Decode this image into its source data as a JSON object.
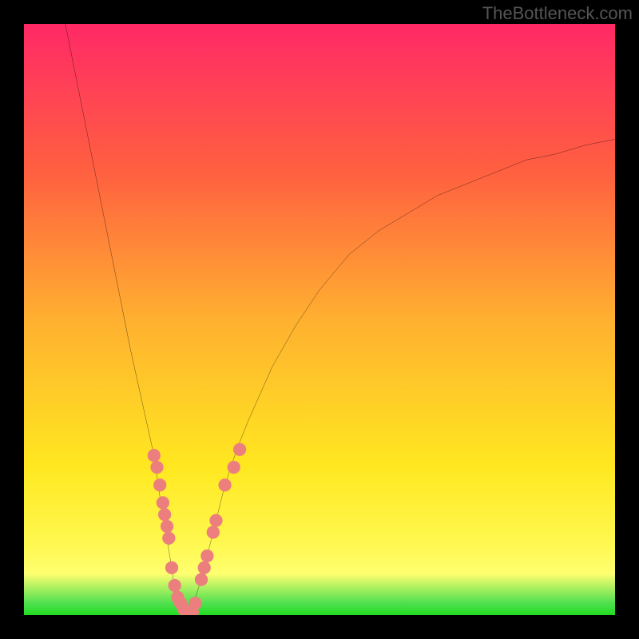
{
  "attribution": "TheBottleneck.com",
  "colors": {
    "background": "#000000",
    "gradient_top": "#FF2966",
    "gradient_upper_mid": "#FF6040",
    "gradient_mid": "#FFB030",
    "gradient_lower_mid": "#FFE820",
    "gradient_bottom_green": "#20DD20",
    "curve": "#000000",
    "markers": "#EC7F7E"
  },
  "chart_data": {
    "type": "line",
    "title": "",
    "xlabel": "",
    "ylabel": "",
    "xlim": [
      0,
      100
    ],
    "ylim": [
      0,
      100
    ],
    "left_curve": {
      "x": [
        7,
        10,
        13,
        16,
        18,
        20,
        22,
        23,
        24,
        25,
        25.5,
        26,
        27,
        28
      ],
      "y": [
        100,
        85,
        70,
        55,
        45,
        36,
        27,
        20,
        14,
        8,
        4,
        2,
        0,
        0
      ]
    },
    "right_curve": {
      "x": [
        28,
        30,
        32,
        34,
        36,
        38,
        42,
        46,
        50,
        55,
        60,
        65,
        70,
        75,
        80,
        85,
        90,
        95,
        100
      ],
      "y": [
        0,
        6,
        14,
        22,
        28,
        33,
        42,
        49,
        55,
        61,
        65,
        68,
        71,
        73,
        75,
        77,
        78,
        79.5,
        80.5
      ]
    },
    "markers": {
      "x": [
        22,
        22.5,
        23,
        23.5,
        23.8,
        24.2,
        24.5,
        25,
        25.5,
        26,
        26.5,
        27,
        27.5,
        28,
        28.5,
        29,
        30,
        30.5,
        31,
        32,
        32.5,
        34,
        35.5,
        36.5
      ],
      "y": [
        27,
        25,
        22,
        19,
        17,
        15,
        13,
        8,
        5,
        3,
        2,
        1,
        0.5,
        0,
        0.5,
        2,
        6,
        8,
        10,
        14,
        16,
        22,
        25,
        28
      ]
    }
  }
}
